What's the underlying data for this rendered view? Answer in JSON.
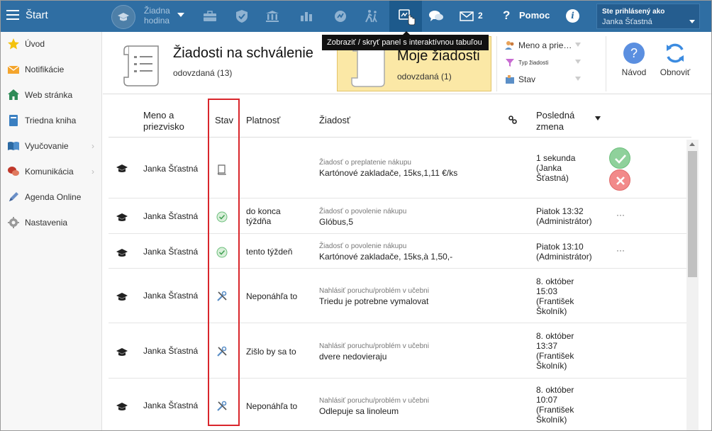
{
  "topbar": {
    "start_label": "Štart",
    "hodina_label": "Žiadna hodina",
    "mail_count": "2",
    "help_label": "Pomoc",
    "info_glyph": "i",
    "user_signed_label": "Ste prihlásený ako",
    "user_name": "Janka Šťastná",
    "icons": [
      "menu-icon",
      "graduation-cap-icon",
      "briefcase-icon",
      "shield-icon",
      "bank-icon",
      "bar-chart-icon",
      "badge-icon",
      "walking-icon",
      "interactive-panel-icon",
      "chat-icon",
      "mail-icon",
      "help-icon",
      "info-icon"
    ],
    "bar_color": "#2f6ea3"
  },
  "tooltip": {
    "text": "Zobraziť / skryť panel s interaktívnou tabuľou"
  },
  "sidebar": {
    "items": [
      {
        "label": "Úvod",
        "icon": "star-icon"
      },
      {
        "label": "Notifikácie",
        "icon": "envelope-icon"
      },
      {
        "label": "Web stránka",
        "icon": "home-icon"
      },
      {
        "label": "Triedna kniha",
        "icon": "book-icon"
      },
      {
        "label": "Vyučovanie",
        "icon": "open-book-icon"
      },
      {
        "label": "Komunikácia",
        "icon": "chat-icon"
      },
      {
        "label": "Agenda Online",
        "icon": "pen-icon"
      },
      {
        "label": "Nastavenia",
        "icon": "gear-icon"
      }
    ]
  },
  "header": {
    "main_title": "Žiadosti na schválenie",
    "main_sub": "odovzdaná (13)",
    "moje_title": "Moje žiadosti",
    "moje_sub": "odovzdaná (1)",
    "filter_name": "Meno a prie…",
    "filter_type": "Typ žiadosti",
    "filter_state": "Stav",
    "navod_label": "Návod",
    "obnovit_label": "Obnoviť"
  },
  "table": {
    "headers": {
      "name": "Meno a priezvisko",
      "name_line1": "Meno a",
      "name_line2": "priezvisko",
      "stav": "Stav",
      "platnost": "Platnosť",
      "ziadost": "Žiadosť",
      "last_line1": "Posledná",
      "last_line2": "zmena"
    },
    "rows": [
      {
        "name": "Janka Šťastná",
        "status": "document-icon",
        "plat1": "",
        "plat2": "",
        "type": "Žiadosť o preplatenie nákupu",
        "desc": "Kartónové zakladače, 15ks,1,11 €/ks",
        "last": [
          "1 sekunda",
          "(Janka",
          "Šťastná)"
        ]
      },
      {
        "name": "Janka Šťastná",
        "status": "approved-icon",
        "plat1": "do konca",
        "plat2": "týždňa",
        "type": "Žiadosť o povolenie nákupu",
        "desc": "Glóbus,5",
        "last": [
          "Piatok 13:32",
          "(Administrátor)"
        ]
      },
      {
        "name": "Janka Šťastná",
        "status": "approved-icon",
        "plat1": "tento týždeň",
        "plat2": "",
        "type": "Žiadosť o povolenie nákupu",
        "desc": "Kartónové zakladače, 15ks,à 1,50,-",
        "last": [
          "Piatok 13:10",
          "(Administrátor)"
        ]
      },
      {
        "name": "Janka Šťastná",
        "status": "tools-icon",
        "plat1": "Neponáhľa to",
        "plat2": "",
        "type": "Nahlásiť poruchu/problém v učebni",
        "desc": "Triedu je potrebne vymalovat",
        "last": [
          "8. október",
          "15:03",
          "(František",
          "Školník)"
        ]
      },
      {
        "name": "Janka Šťastná",
        "status": "tools-icon",
        "plat1": "Zišlo by sa to",
        "plat2": "",
        "type": "Nahlásiť poruchu/problém v učebni",
        "desc": "dvere nedovieraju",
        "last": [
          "8. október",
          "13:37",
          "(František",
          "Školník)"
        ]
      },
      {
        "name": "Janka Šťastná",
        "status": "tools-icon",
        "plat1": "Neponáhľa to",
        "plat2": "",
        "type": "Nahlásiť poruchu/problém v učebni",
        "desc": "Odlepuje sa linoleum",
        "last": [
          "8. október",
          "10:07",
          "(František",
          "Školník)"
        ]
      }
    ],
    "dots": "···"
  },
  "colors": {
    "highlight_border": "#d9262c",
    "moje_bg": "#fbe8a6",
    "approve": "#8fd19b",
    "reject": "#f28a8a"
  }
}
